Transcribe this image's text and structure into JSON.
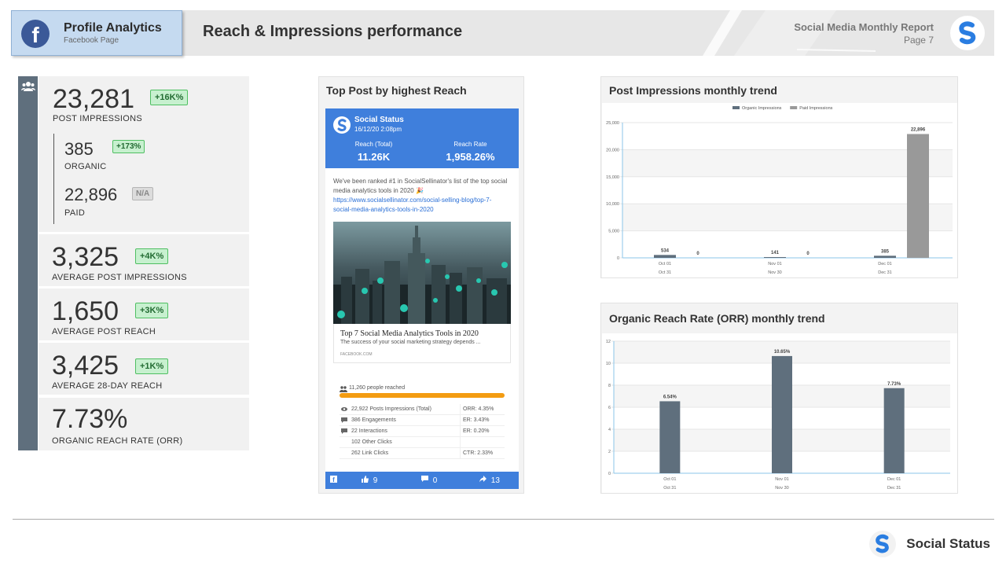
{
  "header": {
    "profile_title": "Profile Analytics",
    "profile_subtitle": "Facebook Page",
    "page_title": "Reach & Impressions performance",
    "report_title": "Social Media Monthly Report",
    "page_number": "Page 7",
    "facebook_glyph": "f"
  },
  "stats": {
    "post_impressions": {
      "value": "23,281",
      "badge": "+16K%",
      "label": "POST IMPRESSIONS"
    },
    "organic": {
      "value": "385",
      "badge": "+173%",
      "label": "ORGANIC"
    },
    "paid": {
      "value": "22,896",
      "badge": "N/A",
      "label": "PAID"
    },
    "avg_post_impressions": {
      "value": "3,325",
      "badge": "+4K%",
      "label": "AVERAGE POST IMPRESSIONS"
    },
    "avg_post_reach": {
      "value": "1,650",
      "badge": "+3K%",
      "label": "AVERAGE POST REACH"
    },
    "avg_28day_reach": {
      "value": "3,425",
      "badge": "+1K%",
      "label": "AVERAGE 28-DAY REACH"
    },
    "orr": {
      "value": "7.73%",
      "label": "ORGANIC  REACH  RATE  (ORR)"
    }
  },
  "top_post": {
    "panel_title": "Top Post by  highest Reach",
    "account": "Social Status",
    "date": "16/12/20 2:08pm",
    "reach_label": "Reach (Total)",
    "reach_value": "11.26K",
    "rate_label": "Reach Rate",
    "rate_value": "1,958.26%",
    "text_line1": "We've been ranked #1 in SocialSellinator's list of the top social",
    "text_line2": "media analytics tools in 2020 🎉",
    "link_line1": "https://www.socialsellinator.com/social-selling-blog/top-7-",
    "link_line2": "social-media-analytics-tools-in-2020",
    "card_title": "Top 7 Social Media Analytics Tools in 2020",
    "card_desc": "The success of your social marketing strategy depends ...",
    "card_domain": "FACEBOOK.COM",
    "people_reached": "11,260 people reached",
    "reached_fraction": 1.0,
    "metrics": [
      {
        "icon": "eye-icon",
        "label": "22,922 Posts Impressions (Total)",
        "rate": "ORR: 4.35%"
      },
      {
        "icon": "comment-icon",
        "label": "386 Engagements",
        "rate": "ER: 3.43%"
      },
      {
        "icon": "comment-icon",
        "label": "22 Interactions",
        "rate": "ER: 0.20%"
      },
      {
        "icon": "",
        "label": "102 Other Clicks",
        "rate": ""
      },
      {
        "icon": "",
        "label": "262 Link Clicks",
        "rate": "CTR: 2.33%"
      }
    ],
    "likes": "9",
    "comments": "0",
    "shares": "13"
  },
  "impressions_chart_title": "Post Impressions monthly trend",
  "orr_chart_title": "Organic Reach Rate (ORR) monthly trend",
  "chart_data": [
    {
      "type": "bar",
      "title": "Post Impressions monthly trend",
      "categories": [
        "Oct 01",
        "Nov 01",
        "Dec 01"
      ],
      "categories_end": [
        "Oct 31",
        "Nov 30",
        "Dec 31"
      ],
      "series": [
        {
          "name": "Organic Impressions",
          "values": [
            534,
            141,
            385
          ],
          "labels": [
            "534",
            "141",
            "385"
          ],
          "color": "#5f6f7d"
        },
        {
          "name": "Paid Impressions",
          "values": [
            0,
            0,
            22896
          ],
          "labels": [
            "0",
            "0",
            "22,896"
          ],
          "color": "#999999"
        }
      ],
      "ylim": [
        0,
        25000
      ],
      "yticks": [
        "0",
        "5,000",
        "10,000",
        "15,000",
        "20,000",
        "25,000"
      ],
      "legend": "top"
    },
    {
      "type": "bar",
      "title": "Organic Reach Rate (ORR) monthly trend",
      "categories": [
        "Oct 01",
        "Nov 01",
        "Dec 01"
      ],
      "categories_end": [
        "Oct 31",
        "Nov 30",
        "Dec 31"
      ],
      "series": [
        {
          "values": [
            6.54,
            10.65,
            7.73
          ],
          "labels": [
            "6.54%",
            "10.65%",
            "7.73%"
          ],
          "color": "#5f6f7d"
        }
      ],
      "ylim": [
        0,
        12
      ],
      "yticks": [
        "0",
        "2",
        "4",
        "6",
        "8",
        "10",
        "12"
      ]
    }
  ],
  "footer": {
    "brand": "Social Status"
  },
  "colors": {
    "accent_blue": "#3f7fdc",
    "slate": "#5f6f7d",
    "green_badge": "#c7f0cf",
    "progress_orange": "#f39c12"
  }
}
